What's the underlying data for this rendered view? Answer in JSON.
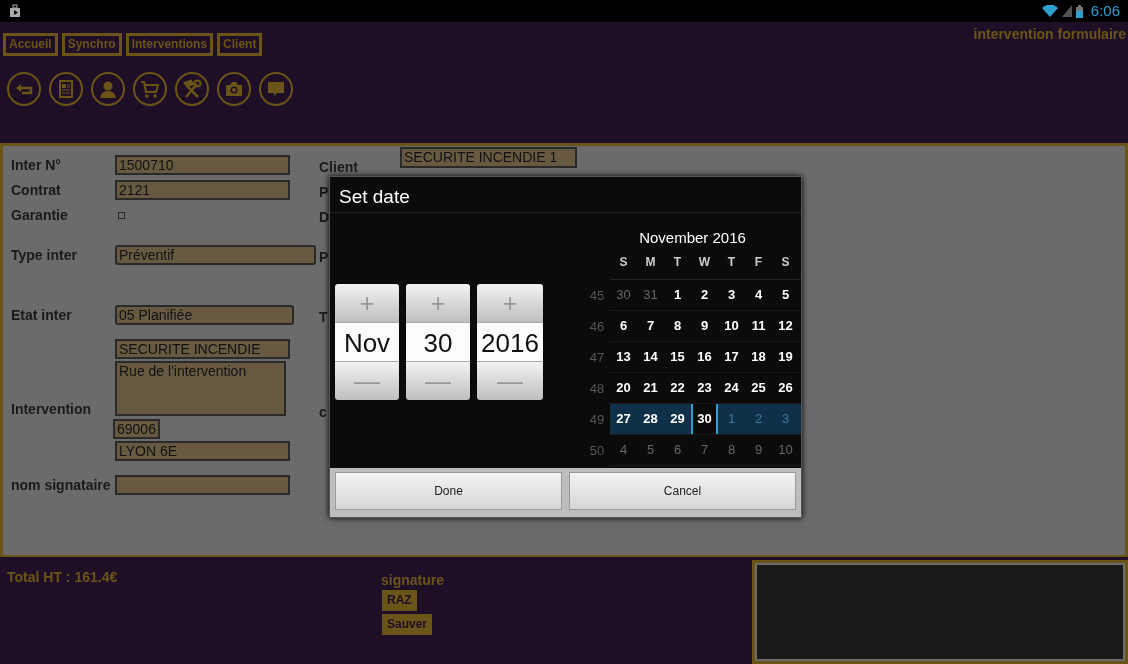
{
  "status_bar": {
    "time": "6:06"
  },
  "nav": [
    {
      "label": "Accueil"
    },
    {
      "label": "Synchro"
    },
    {
      "label": "Interventions"
    },
    {
      "label": "Client"
    }
  ],
  "page_title": "intervention formulaire",
  "toolbar": [
    {
      "kind": "back"
    },
    {
      "kind": "document"
    },
    {
      "kind": "person"
    },
    {
      "kind": "cart"
    },
    {
      "kind": "tools"
    },
    {
      "kind": "camera"
    },
    {
      "kind": "chat"
    }
  ],
  "form": {
    "left": [
      {
        "kind": "field",
        "label": "Inter N°",
        "value": "1500710"
      },
      {
        "kind": "field",
        "label": "Contrat",
        "value": "2121"
      },
      {
        "kind": "checkbox",
        "label": "Garantie",
        "checked": false
      },
      {
        "kind": "select",
        "label": "Type inter",
        "value": "Préventif"
      },
      {
        "kind": "select",
        "label": "Etat inter",
        "value": "05 Planifiée"
      },
      {
        "kind": "address",
        "label": "Intervention",
        "name": "SECURITE INCENDIE",
        "street": "Rue de l'intervention",
        "postcode": "69006",
        "city": "LYON 6E"
      },
      {
        "kind": "field",
        "label": "nom signataire"
      }
    ],
    "right": [
      {
        "kind": "field",
        "label": "Client",
        "value": "SECURITE INCENDIE 1"
      },
      {
        "kind": "fragment",
        "label": "P"
      },
      {
        "kind": "fragment",
        "label": "D"
      },
      {
        "kind": "fragment",
        "label": "P"
      },
      {
        "kind": "fragment",
        "label": "T"
      },
      {
        "kind": "fragment",
        "label": "c"
      }
    ]
  },
  "footer": {
    "total": "Total HT : 161.4€",
    "signature_label": "signature",
    "buttons": [
      "RAZ",
      "Sauver"
    ]
  },
  "dialog": {
    "title": "Set date",
    "pickers": [
      {
        "plus": "+",
        "value": "Nov",
        "minus": "—"
      },
      {
        "plus": "+",
        "value": "30",
        "minus": "—"
      },
      {
        "plus": "+",
        "value": "2016",
        "minus": "—"
      }
    ],
    "calendar": {
      "month": "November 2016",
      "weekdays": [
        "S",
        "M",
        "T",
        "W",
        "T",
        "F",
        "S"
      ],
      "weeks": [
        {
          "number": "45",
          "selected": false,
          "days": [
            {
              "label": "30",
              "muted": true,
              "selected": false
            },
            {
              "label": "31",
              "muted": true,
              "selected": false
            },
            {
              "label": "1",
              "muted": false,
              "selected": false
            },
            {
              "label": "2",
              "muted": false,
              "selected": false
            },
            {
              "label": "3",
              "muted": false,
              "selected": false
            },
            {
              "label": "4",
              "muted": false,
              "selected": false
            },
            {
              "label": "5",
              "muted": false,
              "selected": false
            }
          ]
        },
        {
          "number": "46",
          "selected": false,
          "days": [
            {
              "label": "6",
              "muted": false,
              "selected": false
            },
            {
              "label": "7",
              "muted": false,
              "selected": false
            },
            {
              "label": "8",
              "muted": false,
              "selected": false
            },
            {
              "label": "9",
              "muted": false,
              "selected": false
            },
            {
              "label": "10",
              "muted": false,
              "selected": false
            },
            {
              "label": "11",
              "muted": false,
              "selected": false
            },
            {
              "label": "12",
              "muted": false,
              "selected": false
            }
          ]
        },
        {
          "number": "47",
          "selected": false,
          "days": [
            {
              "label": "13",
              "muted": false,
              "selected": false
            },
            {
              "label": "14",
              "muted": false,
              "selected": false
            },
            {
              "label": "15",
              "muted": false,
              "selected": false
            },
            {
              "label": "16",
              "muted": false,
              "selected": false
            },
            {
              "label": "17",
              "muted": false,
              "selected": false
            },
            {
              "label": "18",
              "muted": false,
              "selected": false
            },
            {
              "label": "19",
              "muted": false,
              "selected": false
            }
          ]
        },
        {
          "number": "48",
          "selected": false,
          "days": [
            {
              "label": "20",
              "muted": false,
              "selected": false
            },
            {
              "label": "21",
              "muted": false,
              "selected": false
            },
            {
              "label": "22",
              "muted": false,
              "selected": false
            },
            {
              "label": "23",
              "muted": false,
              "selected": false
            },
            {
              "label": "24",
              "muted": false,
              "selected": false
            },
            {
              "label": "25",
              "muted": false,
              "selected": false
            },
            {
              "label": "26",
              "muted": false,
              "selected": false
            }
          ]
        },
        {
          "number": "49",
          "selected": true,
          "days": [
            {
              "label": "27",
              "muted": false,
              "selected": false
            },
            {
              "label": "28",
              "muted": false,
              "selected": false
            },
            {
              "label": "29",
              "muted": false,
              "selected": false
            },
            {
              "label": "30",
              "muted": false,
              "selected": true
            },
            {
              "label": "1",
              "muted": true,
              "selected": false
            },
            {
              "label": "2",
              "muted": true,
              "selected": false
            },
            {
              "label": "3",
              "muted": true,
              "selected": false
            }
          ]
        },
        {
          "number": "50",
          "selected": false,
          "days": [
            {
              "label": "4",
              "muted": true,
              "selected": false
            },
            {
              "label": "5",
              "muted": true,
              "selected": false
            },
            {
              "label": "6",
              "muted": true,
              "selected": false
            },
            {
              "label": "7",
              "muted": true,
              "selected": false
            },
            {
              "label": "8",
              "muted": true,
              "selected": false
            },
            {
              "label": "9",
              "muted": true,
              "selected": false
            },
            {
              "label": "10",
              "muted": true,
              "selected": false
            }
          ]
        }
      ]
    },
    "buttons": [
      "Done",
      "Cancel"
    ]
  }
}
